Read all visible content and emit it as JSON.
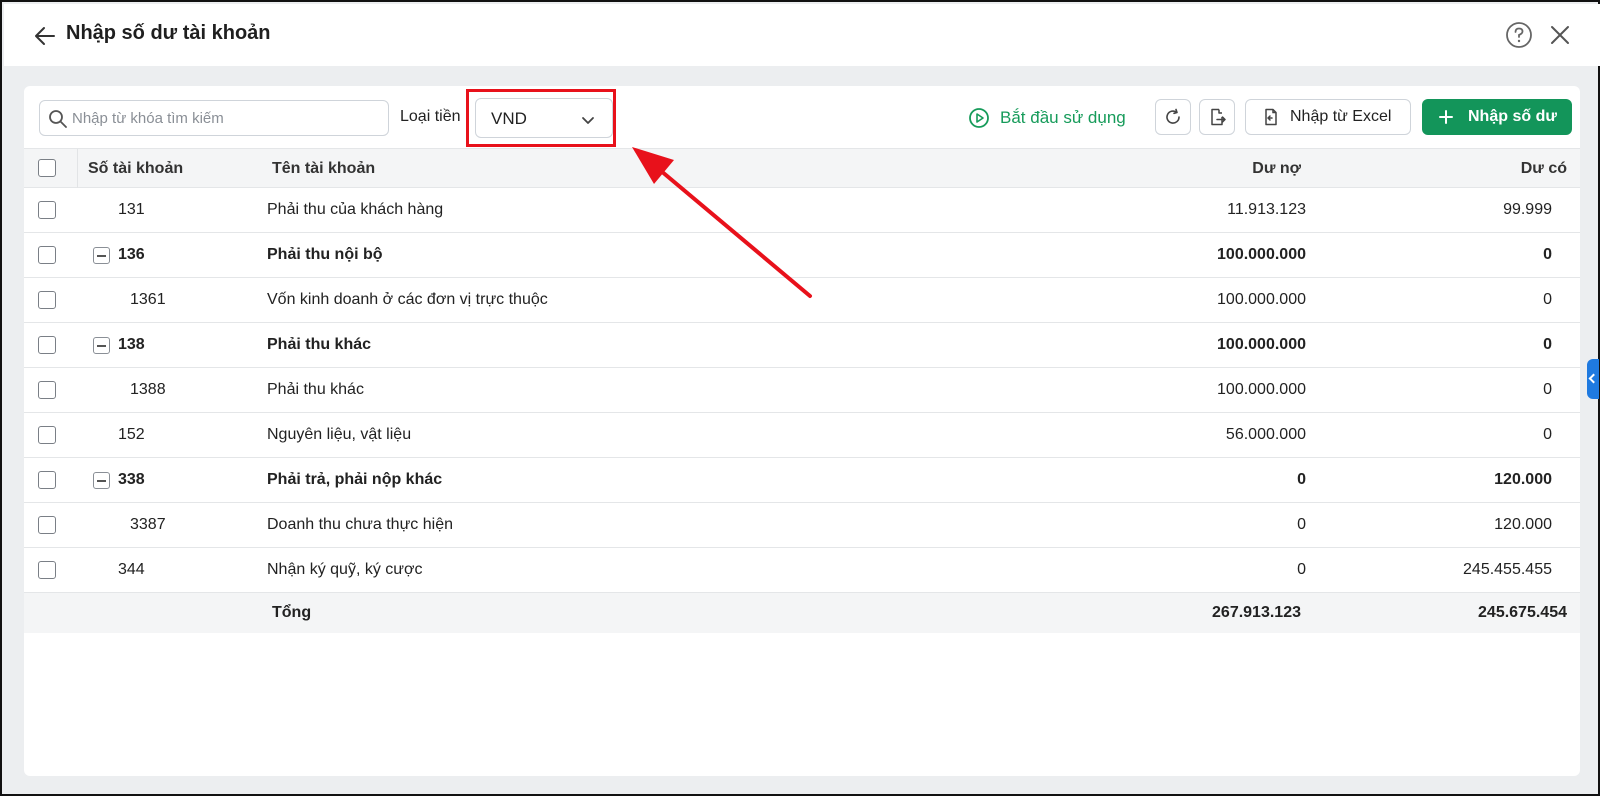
{
  "header": {
    "title": "Nhập số dư tài khoản"
  },
  "toolbar": {
    "search_placeholder": "Nhập từ khóa tìm kiếm",
    "currency_label": "Loại tiền",
    "currency_value": "VND",
    "start_label": "Bắt đầu sử dụng",
    "excel_label": "Nhập từ Excel",
    "add_label": "Nhập số dư"
  },
  "table": {
    "headers": {
      "account_no": "Số tài khoản",
      "account_name": "Tên tài khoản",
      "debit": "Dư nợ",
      "credit": "Dư có"
    },
    "rows": [
      {
        "no": "131",
        "name": "Phải thu của khách hàng",
        "debit": "11.913.123",
        "credit": "99.999"
      },
      {
        "no": "136",
        "name": "Phải thu nội bộ",
        "debit": "100.000.000",
        "credit": "0"
      },
      {
        "no": "1361",
        "name": "Vốn kinh doanh ở các đơn vị trực thuộc",
        "debit": "100.000.000",
        "credit": "0"
      },
      {
        "no": "138",
        "name": "Phải thu khác",
        "debit": "100.000.000",
        "credit": "0"
      },
      {
        "no": "1388",
        "name": "Phải thu khác",
        "debit": "100.000.000",
        "credit": "0"
      },
      {
        "no": "152",
        "name": "Nguyên liệu, vật liệu",
        "debit": "56.000.000",
        "credit": "0"
      },
      {
        "no": "338",
        "name": "Phải trả, phải nộp khác",
        "debit": "0",
        "credit": "120.000"
      },
      {
        "no": "3387",
        "name": "Doanh thu chưa thực hiện",
        "debit": "0",
        "credit": "120.000"
      },
      {
        "no": "344",
        "name": "Nhận ký quỹ, ký cược",
        "debit": "0",
        "credit": "245.455.455"
      }
    ],
    "total": {
      "label": "Tổng",
      "debit": "267.913.123",
      "credit": "245.675.454"
    }
  },
  "colors": {
    "accent_green": "#13955a",
    "highlight_red": "#e8111b",
    "side_tab_blue": "#1f7ae0"
  }
}
